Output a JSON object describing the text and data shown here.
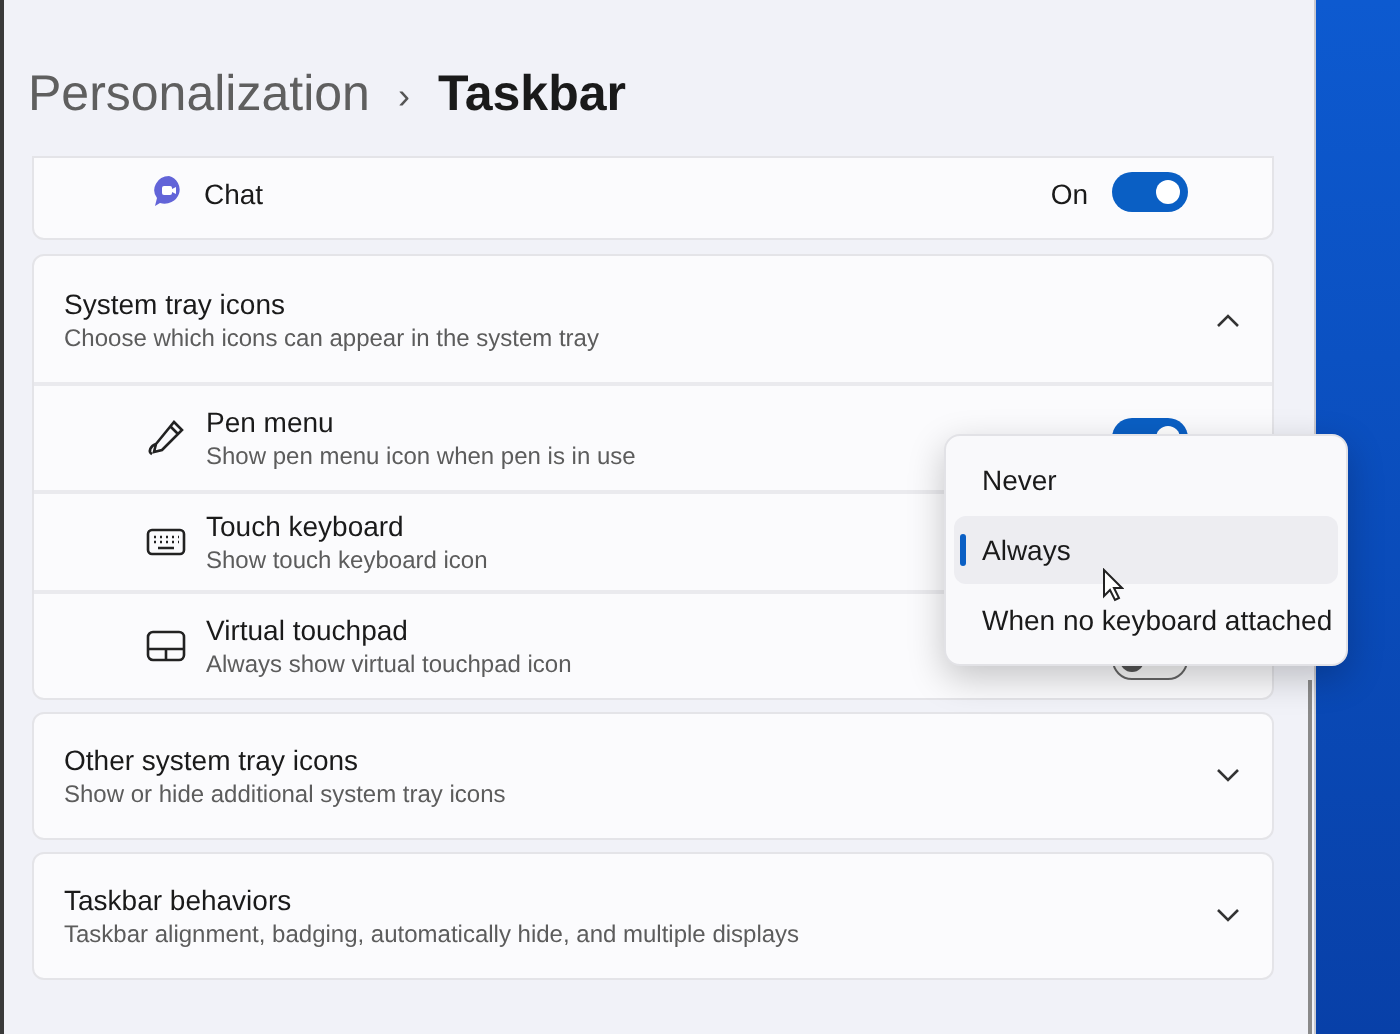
{
  "breadcrumb": {
    "parent": "Personalization",
    "separator": "›",
    "current": "Taskbar"
  },
  "chat": {
    "label": "Chat",
    "status": "On",
    "on": true
  },
  "system_tray": {
    "title": "System tray icons",
    "subtitle": "Choose which icons can appear in the system tray",
    "expanded": true,
    "items": [
      {
        "kind": "pen",
        "title": "Pen menu",
        "subtitle": "Show pen menu icon when pen is in use",
        "on": true
      },
      {
        "kind": "keyboard",
        "title": "Touch keyboard",
        "subtitle": "Show touch keyboard icon"
      },
      {
        "kind": "touchpad",
        "title": "Virtual touchpad",
        "subtitle": "Always show virtual touchpad icon",
        "on": false
      }
    ]
  },
  "sections": [
    {
      "title": "Other system tray icons",
      "subtitle": "Show or hide additional system tray icons",
      "expanded": false
    },
    {
      "title": "Taskbar behaviors",
      "subtitle": "Taskbar alignment, badging, automatically hide, and multiple displays",
      "expanded": false
    }
  ],
  "dropdown": {
    "options": [
      {
        "label": "Never",
        "selected": false
      },
      {
        "label": "Always",
        "selected": true
      },
      {
        "label": "When no keyboard attached",
        "selected": false
      }
    ]
  }
}
